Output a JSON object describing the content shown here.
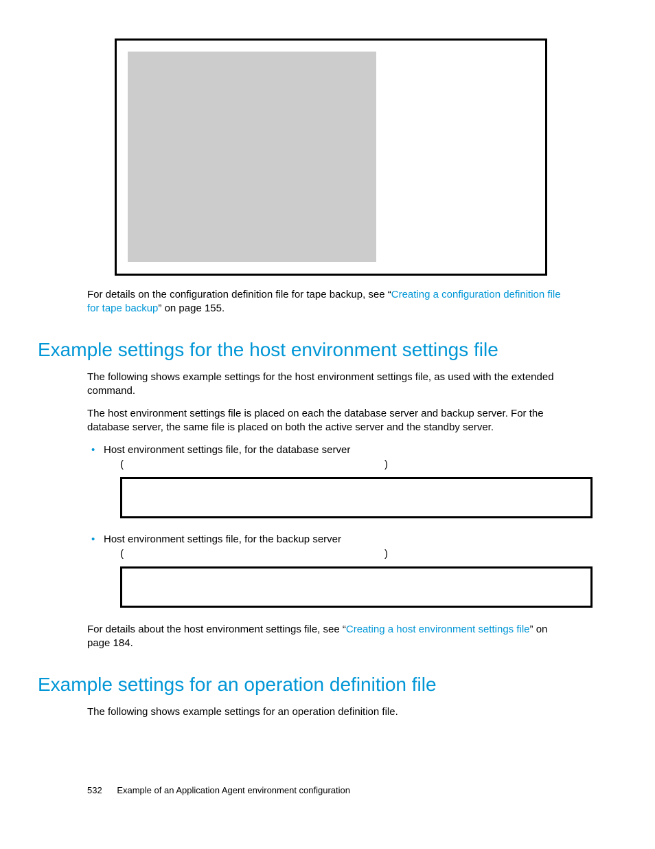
{
  "figure_note": {
    "pre": "For details on the configuration definition file for tape backup, see “",
    "link": "Creating a configuration definition file for tape backup",
    "post": "” on page 155."
  },
  "section1": {
    "heading": "Example settings for the host environment settings file",
    "p1": "The following shows example settings for the host environment settings file, as used with the extended command.",
    "p2": "The host environment settings file is placed on each the database server and backup server. For the database server, the same file is placed on both the active server and the standby server.",
    "bullets": [
      {
        "label": "Host environment settings file, for the database server",
        "paren_l": "(",
        "paren_r": ")",
        "code": ""
      },
      {
        "label": "Host environment settings file, for the backup server",
        "paren_l": "(",
        "paren_r": ")",
        "code": ""
      }
    ],
    "note": {
      "pre": "For details about the host environment settings file, see “",
      "link": "Creating a host environment settings file",
      "post": "” on page 184."
    }
  },
  "section2": {
    "heading": "Example settings for an operation definition file",
    "p1": "The following shows example settings for an operation definition file."
  },
  "footer": {
    "page": "532",
    "title": "Example of an Application Agent environment configuration"
  }
}
